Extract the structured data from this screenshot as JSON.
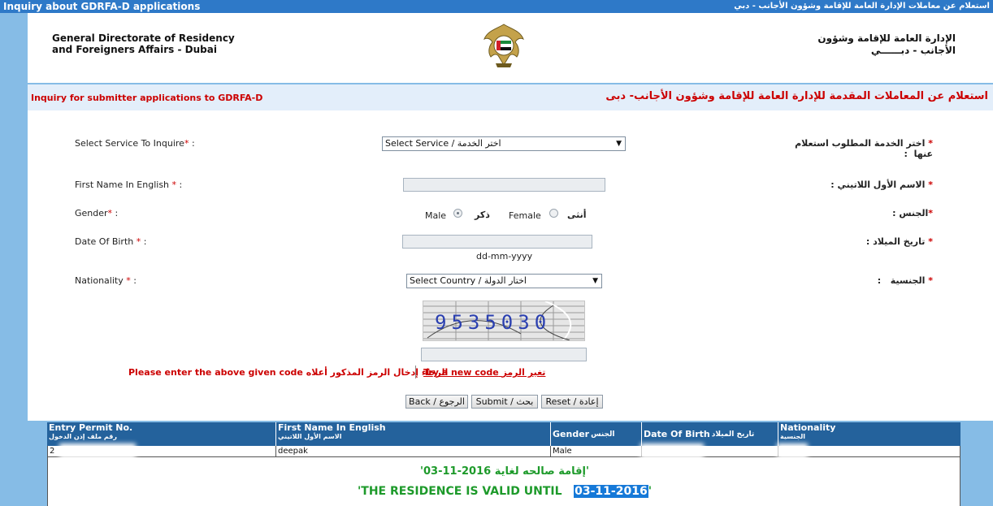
{
  "titlebar": {
    "title_en": "Inquiry about GDRFA-D applications",
    "title_ar": "استعلام عن معاملات الإدارة العامة للإقامة وشؤون الأجانب - دبي"
  },
  "header": {
    "org_en_line1": "General Directorate of Residency",
    "org_en_line2": "and Foreigners Affairs - Dubai",
    "org_ar_line1": "الإدارة العامة للإقامة وشؤون",
    "org_ar_line2": "الأجانب - دبــــــي",
    "emblem_icon": "uae-emblem-icon"
  },
  "strip": {
    "title_en": "Inquiry for submitter applications to GDRFA-D",
    "title_ar": "استعلام عن المعاملات المقدمة للإدارة العامة للإقامة وشؤون الأجانب- دبى"
  },
  "form": {
    "service": {
      "label_en": "Select Service To Inquire",
      "label_ar": "اختر الخدمة المطلوب استعلام عنها",
      "selected": "Select Service / اختر الخدمة"
    },
    "first_name": {
      "label_en": "First Name In English",
      "label_ar": "الاسم الأول اللاتيني",
      "value": ""
    },
    "gender": {
      "label_en": "Gender",
      "label_ar": "الجنس",
      "male_en": "Male",
      "male_ar": "ذكر",
      "female_en": "Female",
      "female_ar": "أنثى",
      "selected": "Male"
    },
    "dob": {
      "label_en": "Date Of Birth",
      "label_ar": "تاريخ الميلاد",
      "value": "",
      "hint": "dd-mm-yyyy"
    },
    "nationality": {
      "label_en": "Nationality",
      "label_ar": "الجنسية",
      "selected": "Select Country / اختار الدولة"
    },
    "captcha": {
      "code_image_text": "9535030",
      "input_value": "",
      "prompt_en": "Please enter the above given code",
      "prompt_ar": "الرجاء إدخال الرمز المذكور أعلاه",
      "try_new_en": "Try a new code",
      "try_new_ar": "تغير الرمز"
    },
    "buttons": {
      "back": "Back / الرجوع",
      "submit": "Submit / بحث",
      "reset": "Reset / إعادة"
    },
    "required_mark": "*",
    "colon": ":"
  },
  "results": {
    "columns": [
      {
        "en": "Entry Permit No.",
        "ar": "رقم ملف إذن الدخول"
      },
      {
        "en": "First Name In English",
        "ar": "الاسم الأول اللاتيني"
      },
      {
        "en": "Gender",
        "ar": "الجنس"
      },
      {
        "en": "Date Of Birth",
        "ar": "تاريخ الميلاد"
      },
      {
        "en": "Nationality",
        "ar": "الجنسية"
      }
    ],
    "row": {
      "entry_permit": "2",
      "first_name": "deepak",
      "gender": "Male",
      "dob": "",
      "nationality": ""
    },
    "status_ar": "'إقامة صالحه لغاية  2016-11-03'",
    "status_en_prefix": "'THE RESIDENCE IS VALID UNTIL ",
    "status_en_date": "03-11-2016",
    "status_en_suffix": "'"
  },
  "colors": {
    "titlebar": "#2e79c8",
    "background": "#86bce6",
    "label_red": "#cc0000",
    "table_header": "#24629c",
    "valid_green": "#1d9a2a",
    "highlight": "#1679d8"
  }
}
